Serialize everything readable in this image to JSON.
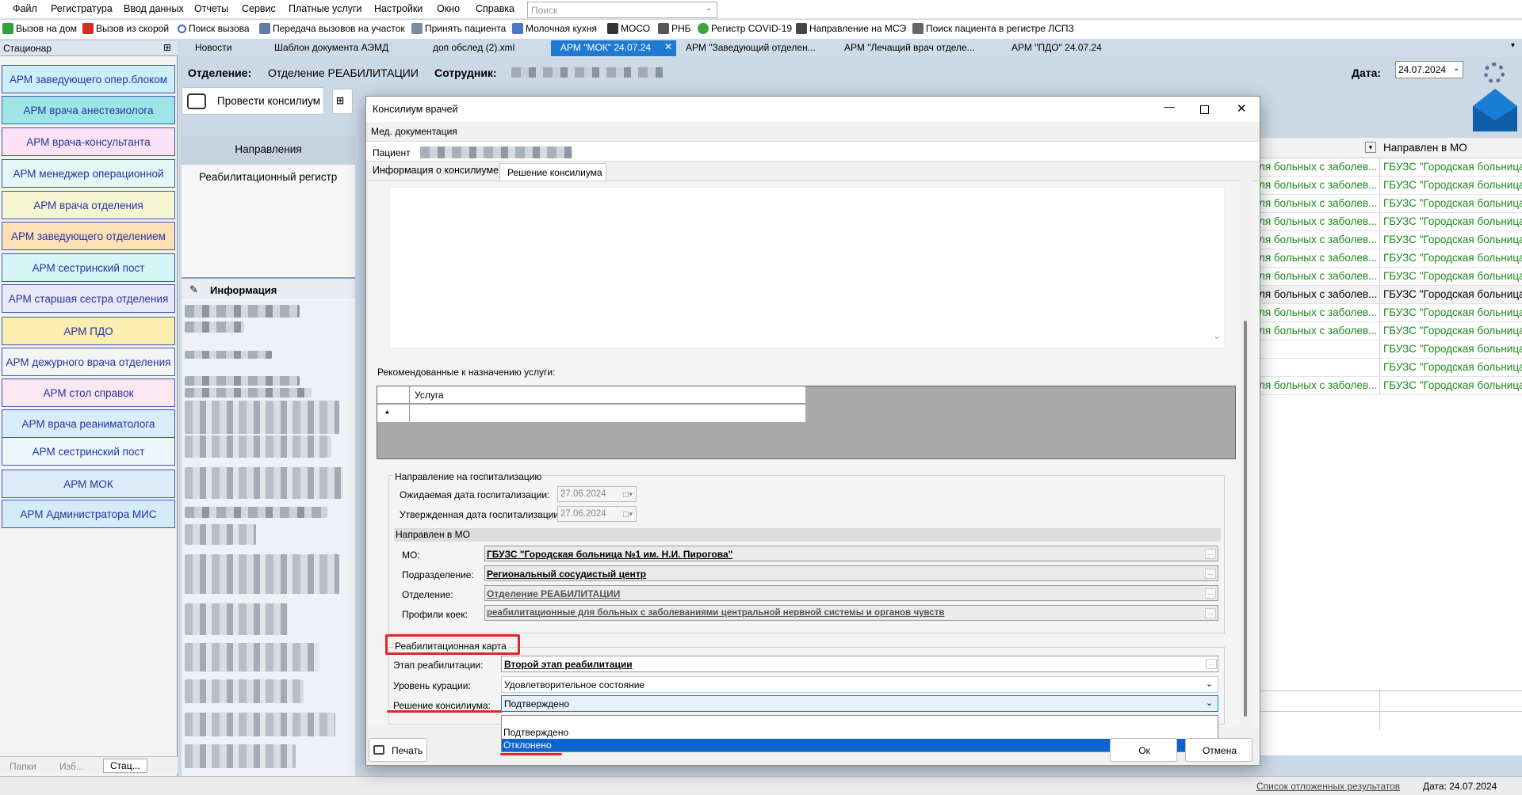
{
  "menu": {
    "items": [
      "Файл",
      "Регистратура",
      "Ввод данных",
      "Отчеты",
      "Сервис",
      "Платные услуги",
      "Настройки",
      "Окно",
      "Справка"
    ],
    "search_placeholder": "Поиск"
  },
  "toolbar": {
    "items": [
      "Вызов на дом",
      "Вызов из скорой",
      "Поиск вызова",
      "Передача вызовов на участок",
      "Принять пациента",
      "Молочная кухня",
      "МОСО",
      "РНБ",
      "Регистр COVID-19",
      "Направление на МСЭ",
      "Поиск пациента в регистре ЛСПЗ"
    ]
  },
  "tabs": {
    "items": [
      "Новости",
      "Шаблон документа АЭМД",
      "доп обслед (2).xml",
      "АРМ \"МОК\" 24.07.24",
      "АРМ \"Заведующий отделен...",
      "АРМ \"Лечащий врач отделе...",
      "АРМ \"ПДО\" 24.07.24"
    ],
    "active_index": 3
  },
  "sidebar": {
    "title": "Стационар",
    "items": [
      {
        "label": "АРМ заведующего опер.блоком",
        "color": "#cdeefb"
      },
      {
        "label": "АРМ врача анестезиолога",
        "color": "#9ee6e6"
      },
      {
        "label": "АРМ врача-консультанта",
        "color": "#fbe3f5"
      },
      {
        "label": "АРМ менеджер  операционной",
        "color": "#e3f7f5"
      },
      {
        "label": "АРМ врача отделения",
        "color": "#f7f6d2"
      },
      {
        "label": "АРМ заведующего отделением",
        "color": "#fde0b6"
      },
      {
        "label": "АРМ сестринский пост",
        "color": "#d6f5f7"
      },
      {
        "label": "АРМ старшая сестра отделения",
        "color": "#e8e8f7"
      },
      {
        "label": "АРМ ПДО",
        "color": "#fbeeb0"
      },
      {
        "label": "АРМ дежурного врача отделения",
        "color": "#f4f4f4"
      },
      {
        "label": "АРМ стол справок",
        "color": "#fbe7f1"
      },
      {
        "label": "АРМ врача реаниматолога",
        "color": "#d9ecf9"
      },
      {
        "label": "АРМ сестринский пост",
        "color": "#ecf6fb"
      },
      {
        "label": "АРМ МОК",
        "color": "#dcebf7"
      },
      {
        "label": "АРМ Администратора МИС",
        "color": "#d4ecf8"
      }
    ],
    "bottom_tabs": [
      "Папки",
      "Изб...",
      "Стац..."
    ]
  },
  "workspace": {
    "dept_label": "Отделение:",
    "dept_value": "Отделение РЕАБИЛИТАЦИИ",
    "employee_label": "Сотрудник:",
    "date_label": "Дата:",
    "date_value": "24.07.2024",
    "konsilium_button": "Провести консилиум",
    "nav_header": "Направления",
    "nav_item": "Реабилитационный регистр",
    "info_header": "Информация"
  },
  "grid": {
    "header": "Направлен в МО",
    "rows": [
      {
        "a": "ля больных с заболев...",
        "b": "ГБУЗС \"Городская больница"
      },
      {
        "a": "ля больных с заболев...",
        "b": "ГБУЗС \"Городская больница"
      },
      {
        "a": "ля больных с заболев...",
        "b": "ГБУЗС \"Городская больница"
      },
      {
        "a": "ля больных с заболев...",
        "b": "ГБУЗС \"Городская больница"
      },
      {
        "a": "ля больных с заболев...",
        "b": "ГБУЗС \"Городская больница"
      },
      {
        "a": "ля больных с заболев...",
        "b": "ГБУЗС \"Городская больница"
      },
      {
        "a": "ля больных с заболев...",
        "b": "ГБУЗС \"Городская больница"
      },
      {
        "a": "ля больных с заболев...",
        "b": "ГБУЗС \"Городская больница"
      },
      {
        "a": "ля больных с заболев...",
        "b": "ГБУЗС \"Городская больница"
      },
      {
        "a": "ля больных с заболев...",
        "b": "ГБУЗС \"Городская больница"
      },
      {
        "a": "",
        "b": "ГБУЗС \"Городская больница"
      },
      {
        "a": "",
        "b": "ГБУЗС \"Городская больница"
      },
      {
        "a": "ля больных с заболев...",
        "b": "ГБУЗС \"Городская больница"
      }
    ]
  },
  "status": {
    "deferred": "Список отложенных результатов",
    "date": "Дата: 24.07.2024"
  },
  "dialog": {
    "title": "Консилиум врачей",
    "meddoc": "Мед. документация",
    "patient_label": "Пациент",
    "tab_info": "Информация о консилиуме",
    "tab_decision": "Решение консилиума",
    "recommended_label": "Рекомендованные к назначению услуги:",
    "service_col": "Услуга",
    "new_row_marker": "*",
    "hosp_group": "Направление на госпитализацию",
    "expected_date_label": "Ожидаемая дата госпитализации:",
    "expected_date": "27.06.2024",
    "approved_date_label": "Утвержденная дата госпитализации:",
    "approved_date": "27.06.2024",
    "mo_header": "Направлен в МО",
    "mo_label": "МО:",
    "mo_value": "ГБУЗС \"Городская больница №1 им. Н.И. Пирогова\"",
    "subdiv_label": "Подразделение:",
    "subdiv_value": "Региональный сосудистый центр",
    "otd_label": "Отделение:",
    "otd_value": "Отделение РЕАБИЛИТАЦИИ",
    "profile_label": "Профили коек:",
    "profile_value": "реабилитационные для больных с заболеваниями центральной нервной системы и органов чувств",
    "rehab_group": "Реабилитационная карта",
    "stage_label": "Этап реабилитации:",
    "stage_value": "Второй этап реабилитации",
    "curation_label": "Уровень курации:",
    "curation_value": "Удовлетворительное состояние",
    "decision_label": "Решение консилиума:",
    "decision_value": "Подтверждено",
    "decision_options": [
      "Подтверждено",
      "Отклонено"
    ],
    "print_button": "Печать",
    "ok_button": "Ок",
    "cancel_button": "Отмена"
  },
  "colors": {
    "accent": "#1e7ad2",
    "highlight_red": "#e0262a",
    "grid_text": "#1a8a1a",
    "selected_option": "#0a64d2"
  }
}
